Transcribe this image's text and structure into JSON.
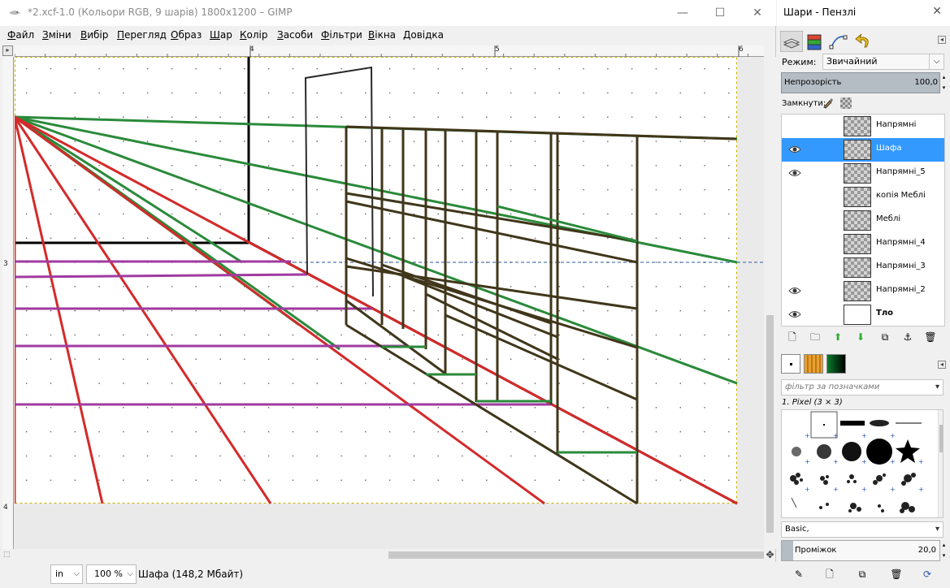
{
  "window": {
    "title": "*2.xcf-1.0 (Кольори RGB, 9 шарів) 1800x1200 – GIMP",
    "minimize": "—",
    "maximize": "☐",
    "close": "✕"
  },
  "menu": [
    "Файл",
    "Зміни",
    "Вибір",
    "Перегляд",
    "Образ",
    "Шар",
    "Колір",
    "Засоби",
    "Фільтри",
    "Вікна",
    "Довідка"
  ],
  "rulers": {
    "horizontal_labels": [
      "4",
      "5",
      "6"
    ],
    "vertical_labels": [
      "3",
      "4"
    ]
  },
  "statusbar": {
    "unit": "in",
    "zoom": "100 %",
    "info": "Шафа (148,2 Мбайт)"
  },
  "dock": {
    "title": "Шари - Пензлі",
    "mode_label": "Режим:",
    "mode_value": "Звичайний",
    "opacity_label": "Непрозорість",
    "opacity_value": "100,0",
    "lock_label": "Замкнути:",
    "layers": [
      {
        "name": "Напрямні",
        "visible": false,
        "selected": false,
        "bold": false
      },
      {
        "name": "Шафа",
        "visible": true,
        "selected": true,
        "bold": false
      },
      {
        "name": "Напрямні_5",
        "visible": true,
        "selected": false,
        "bold": false
      },
      {
        "name": "копія Меблі",
        "visible": false,
        "selected": false,
        "bold": false
      },
      {
        "name": "Меблі",
        "visible": false,
        "selected": false,
        "bold": false
      },
      {
        "name": "Напрямні_4",
        "visible": false,
        "selected": false,
        "bold": false
      },
      {
        "name": "Напрямні_3",
        "visible": false,
        "selected": false,
        "bold": false
      },
      {
        "name": "Напрямні_2",
        "visible": true,
        "selected": false,
        "bold": false
      },
      {
        "name": "Тло",
        "visible": true,
        "selected": false,
        "bold": true
      }
    ],
    "brush_filter_placeholder": "фільтр за позначками",
    "brush_name": "1. Pixel (3 × 3)",
    "brush_set": "Basic,",
    "spacing_label": "Проміжок",
    "spacing_value": "20,0"
  },
  "colors": {
    "green": "#2a8a3a",
    "red": "#d42a2a",
    "purple": "#a03aa0",
    "brown": "#40361a",
    "selection": "#3399ff"
  }
}
